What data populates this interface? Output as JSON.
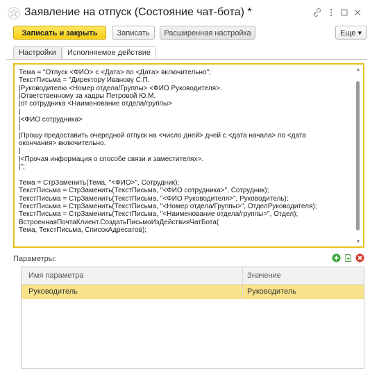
{
  "window": {
    "title": "Заявление на отпуск (Состояние чат-бота) *"
  },
  "toolbar": {
    "save_close_label": "Записать и закрыть",
    "save_label": "Записать",
    "advanced_label": "Расширенная настройка",
    "more_label": "Еще ▾"
  },
  "tabs": [
    {
      "label": "Настройки",
      "active": false
    },
    {
      "label": "Исполняемое действие",
      "active": true
    }
  ],
  "code_lines": [
    "Тема = \"Отпуск <ФИО> с <Дата> по <Дата> включительно\";",
    "ТекстПисьма = \"Директору Иванову С.П.",
    "|Руководителю <Номер отдела/Группы> <ФИО Руководителя>.",
    "|Ответственному за кадры Петровой Ю.М.",
    "|от сотрудника <Наименование отдела/группы>",
    "|",
    "|<ФИО сотрудника>",
    "|",
    "|Прошу предоставить очередной отпуск на <число дней> дней с <дата начала> по <дата",
    "окончания> включительно.",
    "|",
    "|<Прочая информация о способе связи и заместителях>.",
    "|\";",
    "",
    "Тема = СтрЗаменить(Тема, \"<ФИО>\", Сотрудник);",
    "ТекстПисьма = СтрЗаменить(ТекстПисьма, \"<ФИО сотрудника>\", Сотрудник);",
    "ТекстПисьма = СтрЗаменить(ТекстПисьма, \"<ФИО Руководителя>\", Руководитель);",
    "ТекстПисьма = СтрЗаменить(ТекстПисьма, \"<Номер отдела/Группы>\", ОтделРуководителя);",
    "ТекстПисьма = СтрЗаменить(ТекстПисьма, \"<Наименование отдела/группы>\", Отдел);",
    "ВстроеннаяПочтаКлиент.СоздатьПисьмоИзДействияЧатБота(",
    "Тема, ТекстПисьма, СписокАдресатов);"
  ],
  "params": {
    "label": "Параметры:",
    "columns": [
      "Имя параметра",
      "Значение"
    ],
    "rows": [
      {
        "name": "Руководитель",
        "value": "Руководитель"
      }
    ]
  },
  "colors": {
    "accent": "#f6cf14",
    "selection": "#f9e38a",
    "add": "#3aa53a",
    "delete": "#d63a2e"
  }
}
